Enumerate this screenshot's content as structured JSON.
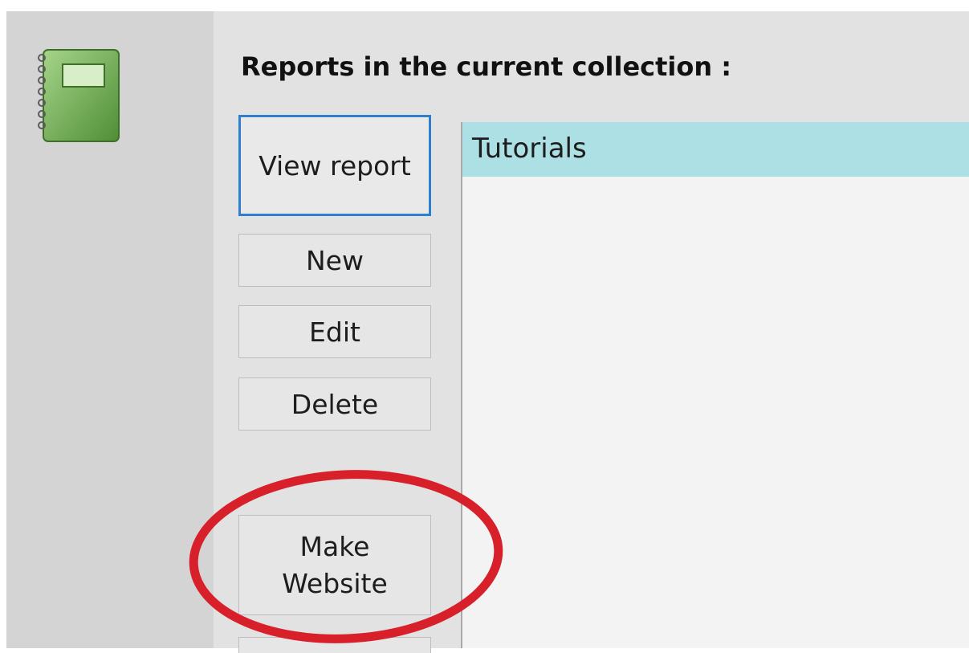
{
  "header": {
    "title": "Reports in the current collection :"
  },
  "icons": {
    "app_icon": "spiral-notebook-icon"
  },
  "buttons": {
    "view_report": "View report",
    "new": "New",
    "edit": "Edit",
    "delete": "Delete",
    "make_website_line1": "Make",
    "make_website_line2": "Website"
  },
  "reports": {
    "items": [
      {
        "label": "Tutorials",
        "selected": true
      }
    ]
  },
  "colors": {
    "selection": "#ace0e4",
    "focus_border": "#2f7fcf",
    "annotation": "#d8202a",
    "notebook_green": "#6fae4c"
  }
}
